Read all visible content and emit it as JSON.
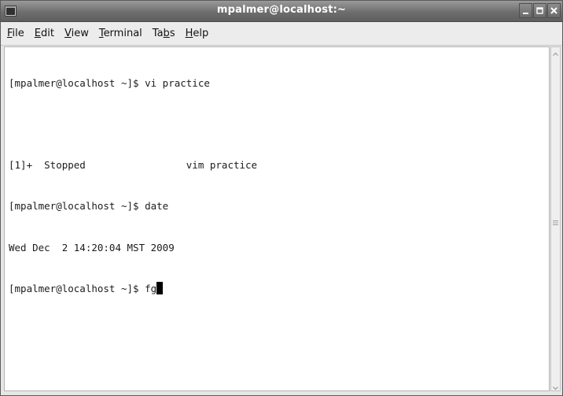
{
  "window": {
    "title": "mpalmer@localhost:~",
    "icons": {
      "app": "terminal-app-icon",
      "minimize": "minimize-icon",
      "maximize": "maximize-icon",
      "close": "close-icon"
    }
  },
  "menubar": {
    "items": [
      {
        "pre": "",
        "mnemonic": "F",
        "post": "ile"
      },
      {
        "pre": "",
        "mnemonic": "E",
        "post": "dit"
      },
      {
        "pre": "",
        "mnemonic": "V",
        "post": "iew"
      },
      {
        "pre": "",
        "mnemonic": "T",
        "post": "erminal"
      },
      {
        "pre": "Ta",
        "mnemonic": "b",
        "post": "s"
      },
      {
        "pre": "",
        "mnemonic": "H",
        "post": "elp"
      }
    ]
  },
  "terminal": {
    "lines": [
      "[mpalmer@localhost ~]$ vi practice",
      "",
      "[1]+  Stopped                 vim practice",
      "[mpalmer@localhost ~]$ date",
      "Wed Dec  2 14:20:04 MST 2009",
      "[mpalmer@localhost ~]$ fg"
    ]
  },
  "colors": {
    "titlebar": "#6e6e6e",
    "terminal_bg": "#ffffff",
    "terminal_fg": "#1c1c1c"
  }
}
